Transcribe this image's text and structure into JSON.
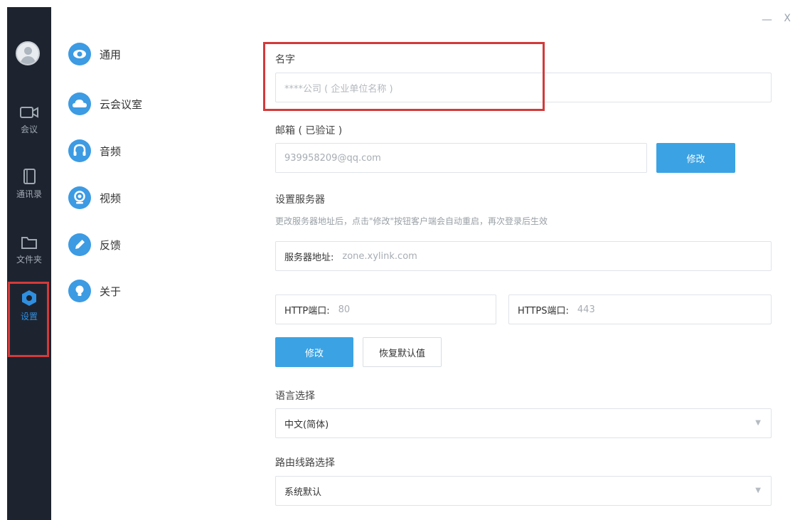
{
  "window": {
    "minimize": "—",
    "close": "X"
  },
  "nav": {
    "items": [
      {
        "label": "会议",
        "icon": "video-camera-icon"
      },
      {
        "label": "通讯录",
        "icon": "contacts-book-icon"
      },
      {
        "label": "文件夹",
        "icon": "folder-icon"
      },
      {
        "label": "设置",
        "icon": "settings-hexagon-icon",
        "active": true
      }
    ]
  },
  "categories": [
    {
      "label": "通用",
      "icon": "eye-icon"
    },
    {
      "label": "云会议室",
      "icon": "cloud-icon"
    },
    {
      "label": "音频",
      "icon": "headphones-icon"
    },
    {
      "label": "视频",
      "icon": "webcam-icon"
    },
    {
      "label": "反馈",
      "icon": "pencil-icon"
    },
    {
      "label": "关于",
      "icon": "lightbulb-icon"
    }
  ],
  "form": {
    "name_label": "名字",
    "name_placeholder": "****公司 ( 企业单位名称 )",
    "email_label": "邮箱 ( 已验证 )",
    "email_value": "939958209@qq.com",
    "email_modify": "修改",
    "server_label": "设置服务器",
    "server_hint": "更改服务器地址后，点击\"修改\"按钮客户端会自动重启，再次登录后生效",
    "server_addr_label": "服务器地址:",
    "server_addr_value": "zone.xylink.com",
    "http_label": "HTTP端口:",
    "http_value": "80",
    "https_label": "HTTPS端口:",
    "https_value": "443",
    "modify_button": "修改",
    "reset_button": "恢复默认值",
    "language_label": "语言选择",
    "language_value": "中文(简体)",
    "route_label": "路由线路选择",
    "route_value": "系统默认"
  },
  "colors": {
    "accent": "#3ba3e4",
    "sidebar": "#1d2430",
    "highlight_border": "#d33a3a"
  }
}
